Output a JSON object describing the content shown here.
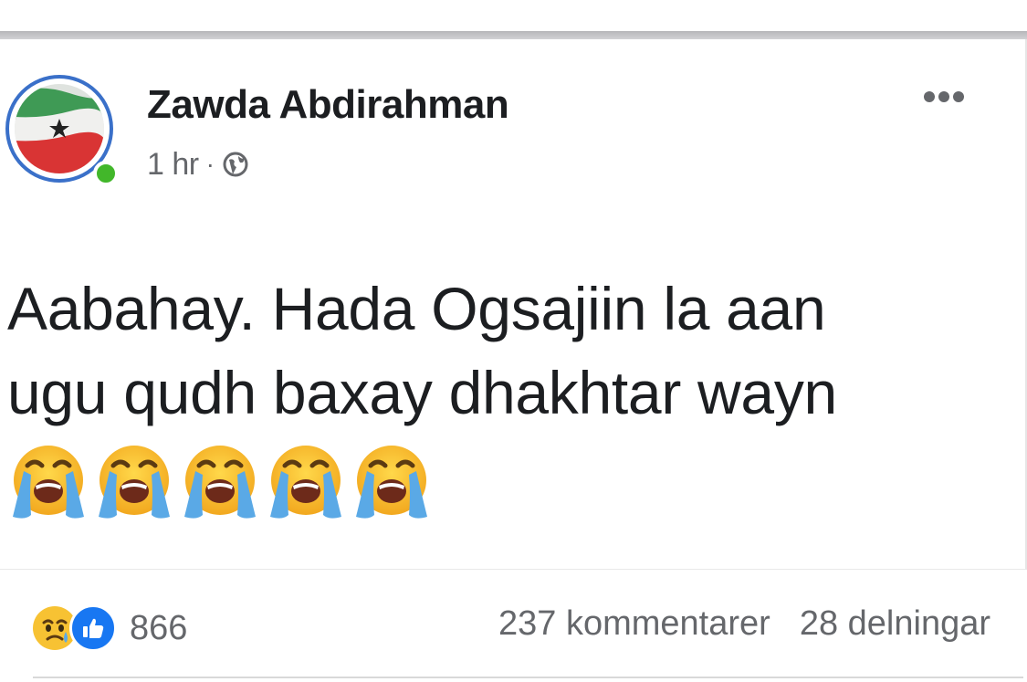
{
  "post": {
    "author": "Zawda Abdirahman",
    "time": "1 hr",
    "separator": "·",
    "audience_icon": "globe-icon",
    "more_icon": "more-options-icon",
    "text_line1": "Aabahay. Hada Ogsajiin la aan",
    "text_line2": "ugu qudh baxay dhakhtar wayn",
    "emojis": [
      "loudly-crying-face",
      "loudly-crying-face",
      "loudly-crying-face",
      "loudly-crying-face",
      "loudly-crying-face"
    ]
  },
  "engagement": {
    "reaction_icons": [
      "sad-reaction-icon",
      "like-reaction-icon"
    ],
    "reaction_count": "866",
    "comments": "237 kommentarer",
    "shares": "28 delningar"
  },
  "colors": {
    "ring": "#3a70c9",
    "online": "#42b72a",
    "like": "#1877f2",
    "text": "#1c1e21",
    "muted": "#65676b"
  }
}
